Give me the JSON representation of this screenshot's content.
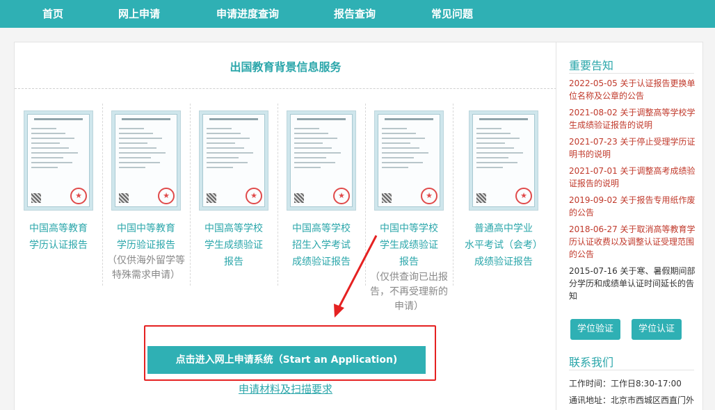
{
  "nav": {
    "items": [
      "首页",
      "网上申请",
      "申请进度查询",
      "报告查询",
      "常见问题"
    ]
  },
  "main": {
    "title": "出国教育背景信息服务",
    "services": [
      {
        "title_lines": [
          "中国高等教育",
          "学历认证报告"
        ],
        "note_lines": []
      },
      {
        "title_lines": [
          "中国中等教育",
          "学历验证报告"
        ],
        "note_lines": [
          "（仅供海外留学等",
          "特殊需求申请）"
        ]
      },
      {
        "title_lines": [
          "中国高等学校",
          "学生成绩验证",
          "报告"
        ],
        "note_lines": []
      },
      {
        "title_lines": [
          "中国高等学校",
          "招生入学考试",
          "成绩验证报告"
        ],
        "note_lines": []
      },
      {
        "title_lines": [
          "中国中等学校",
          "学生成绩验证",
          "报告"
        ],
        "note_lines": [
          "（仅供查询已出报",
          "告，不再受理新的",
          "申请）"
        ]
      },
      {
        "title_lines": [
          "普通高中学业",
          "水平考试（会考）",
          "成绩验证报告"
        ],
        "note_lines": []
      }
    ],
    "apply_button": "点击进入网上申请系统（Start an Application)",
    "requirements_link": "申请材料及扫描要求"
  },
  "sidebar": {
    "notices_heading": "重要告知",
    "notices": [
      {
        "text": "2022-05-05 关于认证报告更换单位名称及公章的公告",
        "color": "#c0392b"
      },
      {
        "text": "2021-08-02 关于调整高等学校学生成绩验证报告的说明",
        "color": "#c0392b"
      },
      {
        "text": "2021-07-23 关于停止受理学历证明书的说明",
        "color": "#c0392b"
      },
      {
        "text": "2021-07-01 关于调整高考成绩验证报告的说明",
        "color": "#c0392b"
      },
      {
        "text": "2019-09-02 关于报告专用纸作废的公告",
        "color": "#c0392b"
      },
      {
        "text": "2018-06-27 关于取消高等教育学历认证收费以及调整认证受理范围的公告",
        "color": "#c0392b"
      },
      {
        "text": "2015-07-16 关于寒、暑假期间部分学历和成绩单认证时间延长的告知",
        "color": "#333333"
      }
    ],
    "buttons": [
      "学位验证",
      "学位认证"
    ],
    "contact_heading": "联系我们",
    "contact": {
      "hours": "工作时间：工作日8:30-17:00",
      "address": "通讯地址：北京市西城区西直门外"
    }
  },
  "colors": {
    "accent": "#2fb0b4",
    "notice_red": "#c0392b",
    "highlight_box": "#e52121"
  }
}
